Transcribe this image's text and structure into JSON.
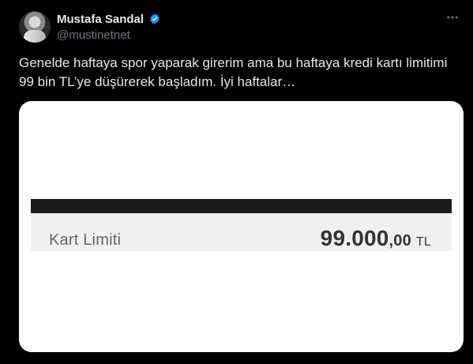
{
  "tweet": {
    "author": {
      "name": "Mustafa Sandal",
      "handle": "@mustinetnet"
    },
    "text": "Genelde haftaya spor yaparak girerim ama bu haftaya kredi kartı limitimi\n99 bin TL’ye düşürerek başladım. İyi haftalar…",
    "menu_icon": "more-icon"
  },
  "media": {
    "label": "Kart Limiti",
    "amount_main": "99.000",
    "amount_decimals": ",00",
    "amount_currency": "TL"
  },
  "colors": {
    "background": "#000000",
    "text": "#e7e9ea",
    "muted": "#71767b",
    "verified": "#1d9bf0"
  }
}
